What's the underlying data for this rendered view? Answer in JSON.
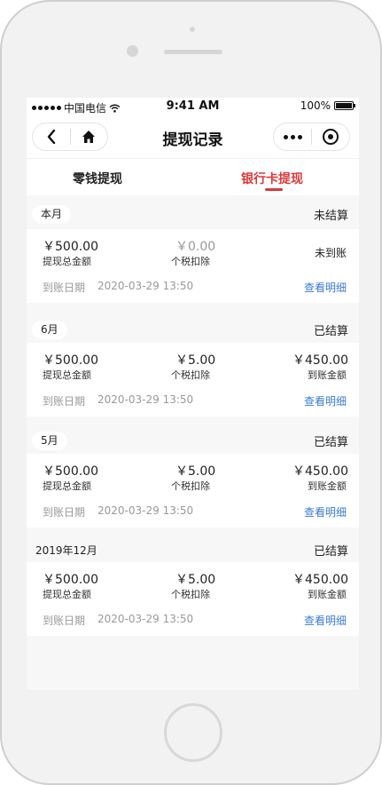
{
  "status_bar": {
    "carrier": "中国电信",
    "time": "9:41 AM",
    "battery": "100%"
  },
  "nav": {
    "title": "提现记录"
  },
  "tabs": [
    {
      "label": "零钱提现",
      "active": false
    },
    {
      "label": "银行卡提现",
      "active": true
    }
  ],
  "labels": {
    "total": "提现总金额",
    "tax": "个税扣除",
    "received": "到账金额",
    "date_label": "到账日期",
    "detail_link": "查看明细"
  },
  "groups": [
    {
      "month": "本月",
      "settle_status": "未结算",
      "total": "￥500.00",
      "tax": "￥0.00",
      "status_text": "未到账",
      "date": "2020-03-29 13:50"
    },
    {
      "month": "6月",
      "settle_status": "已结算",
      "total": "￥500.00",
      "tax": "￥5.00",
      "received": "￥450.00",
      "date": "2020-03-29 13:50"
    },
    {
      "month": "5月",
      "settle_status": "已结算",
      "total": "￥500.00",
      "tax": "￥5.00",
      "received": "￥450.00",
      "date": "2020-03-29 13:50"
    },
    {
      "month": "2019年12月",
      "settle_status": "已结算",
      "total": "￥500.00",
      "tax": "￥5.00",
      "received": "￥450.00",
      "date": "2020-03-29 13:50"
    }
  ],
  "colors": {
    "accent": "#d93a3a",
    "link": "#3b7bd1",
    "muted": "#999999"
  }
}
